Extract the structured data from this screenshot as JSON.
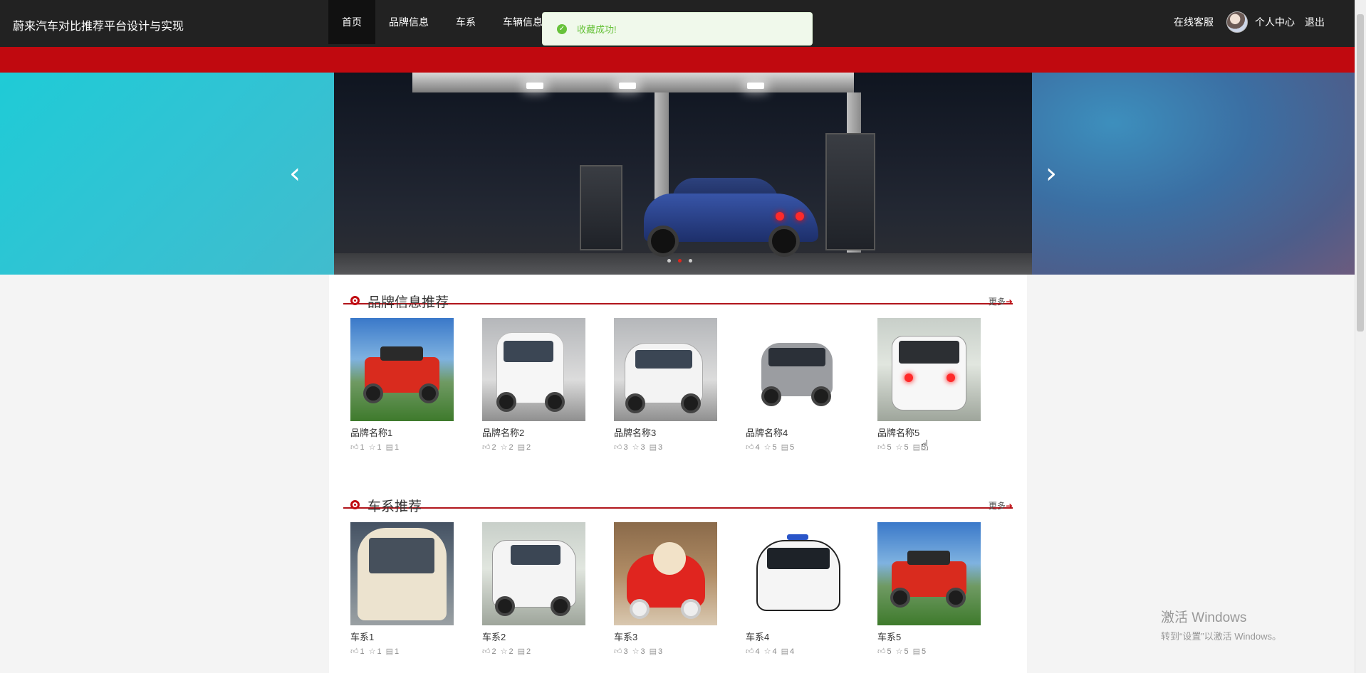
{
  "header": {
    "site_title": "蔚来汽车对比推荐平台设计与实现",
    "nav": [
      {
        "label": "首页",
        "active": true
      },
      {
        "label": "品牌信息",
        "active": false
      },
      {
        "label": "车系",
        "active": false
      },
      {
        "label": "车辆信息",
        "active": false
      }
    ],
    "online_service": "在线客服",
    "personal_center": "个人中心",
    "logout": "退出"
  },
  "toast": {
    "type": "success",
    "message": "收藏成功!"
  },
  "carousel": {
    "prev_icon": "chevron-left-icon",
    "next_icon": "chevron-right-icon",
    "slide_count": 3,
    "active_index": 1
  },
  "sections": [
    {
      "title": "品牌信息推荐",
      "more": "更多",
      "items": [
        {
          "name": "品牌名称1",
          "likes": "1",
          "favorites": "1",
          "comments": "1"
        },
        {
          "name": "品牌名称2",
          "likes": "2",
          "favorites": "2",
          "comments": "2"
        },
        {
          "name": "品牌名称3",
          "likes": "3",
          "favorites": "3",
          "comments": "3"
        },
        {
          "name": "品牌名称4",
          "likes": "4",
          "favorites": "5",
          "comments": "5"
        },
        {
          "name": "品牌名称5",
          "likes": "5",
          "favorites": "5",
          "comments": "5"
        }
      ]
    },
    {
      "title": "车系推荐",
      "more": "更多",
      "items": [
        {
          "name": "车系1",
          "likes": "1",
          "favorites": "1",
          "comments": "1"
        },
        {
          "name": "车系2",
          "likes": "2",
          "favorites": "2",
          "comments": "2"
        },
        {
          "name": "车系3",
          "likes": "3",
          "favorites": "3",
          "comments": "3"
        },
        {
          "name": "车系4",
          "likes": "4",
          "favorites": "4",
          "comments": "4"
        },
        {
          "name": "车系5",
          "likes": "5",
          "favorites": "5",
          "comments": "5"
        }
      ]
    }
  ],
  "watermark": {
    "line1": "激活 Windows",
    "line2": "转到“设置”以激活 Windows。"
  },
  "colors": {
    "topbar": "#222222",
    "accent_red": "#c0090f",
    "toast_green": "#67c23a"
  }
}
